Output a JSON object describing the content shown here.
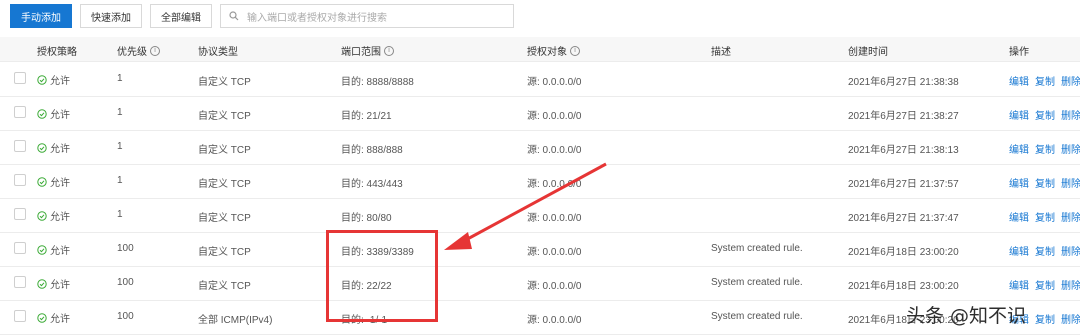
{
  "toolbar": {
    "add_manual": "手动添加",
    "add_quick": "快速添加",
    "edit_all": "全部编辑",
    "search_placeholder": "输入端口或者授权对象进行搜索"
  },
  "table": {
    "headers": {
      "policy": "授权策略",
      "priority": "优先级",
      "protocol": "协议类型",
      "port": "端口范围",
      "target": "授权对象",
      "desc": "描述",
      "created": "创建时间",
      "actions": "操作"
    },
    "rows": [
      {
        "policy": "允许",
        "priority": "1",
        "protocol": "自定义 TCP",
        "port": "目的: 8888/8888",
        "target": "源: 0.0.0.0/0",
        "desc": "",
        "created": "2021年6月27日 21:38:38",
        "edit": "编辑",
        "copy": "复制",
        "delete": "删除"
      },
      {
        "policy": "允许",
        "priority": "1",
        "protocol": "自定义 TCP",
        "port": "目的: 21/21",
        "target": "源: 0.0.0.0/0",
        "desc": "",
        "created": "2021年6月27日 21:38:27",
        "edit": "编辑",
        "copy": "复制",
        "delete": "删除"
      },
      {
        "policy": "允许",
        "priority": "1",
        "protocol": "自定义 TCP",
        "port": "目的: 888/888",
        "target": "源: 0.0.0.0/0",
        "desc": "",
        "created": "2021年6月27日 21:38:13",
        "edit": "编辑",
        "copy": "复制",
        "delete": "删除"
      },
      {
        "policy": "允许",
        "priority": "1",
        "protocol": "自定义 TCP",
        "port": "目的: 443/443",
        "target": "源: 0.0.0.0/0",
        "desc": "",
        "created": "2021年6月27日 21:37:57",
        "edit": "编辑",
        "copy": "复制",
        "delete": "删除"
      },
      {
        "policy": "允许",
        "priority": "1",
        "protocol": "自定义 TCP",
        "port": "目的: 80/80",
        "target": "源: 0.0.0.0/0",
        "desc": "",
        "created": "2021年6月27日 21:37:47",
        "edit": "编辑",
        "copy": "复制",
        "delete": "删除"
      },
      {
        "policy": "允许",
        "priority": "100",
        "protocol": "自定义 TCP",
        "port": "目的: 3389/3389",
        "target": "源: 0.0.0.0/0",
        "desc": "System created rule.",
        "created": "2021年6月18日 23:00:20",
        "edit": "编辑",
        "copy": "复制",
        "delete": "删除"
      },
      {
        "policy": "允许",
        "priority": "100",
        "protocol": "自定义 TCP",
        "port": "目的: 22/22",
        "target": "源: 0.0.0.0/0",
        "desc": "System created rule.",
        "created": "2021年6月18日 23:00:20",
        "edit": "编辑",
        "copy": "复制",
        "delete": "删除"
      },
      {
        "policy": "允许",
        "priority": "100",
        "protocol": "全部 ICMP(IPv4)",
        "port": "目的: -1/-1",
        "target": "源: 0.0.0.0/0",
        "desc": "System created rule.",
        "created": "2021年6月18日 23:00:20",
        "edit": "编辑",
        "copy": "复制",
        "delete": "删除"
      }
    ]
  },
  "watermark": "头条 @知不识",
  "colors": {
    "accent": "#1677d2",
    "allow_green": "#3aaa35",
    "annotation_red": "#e63535"
  }
}
